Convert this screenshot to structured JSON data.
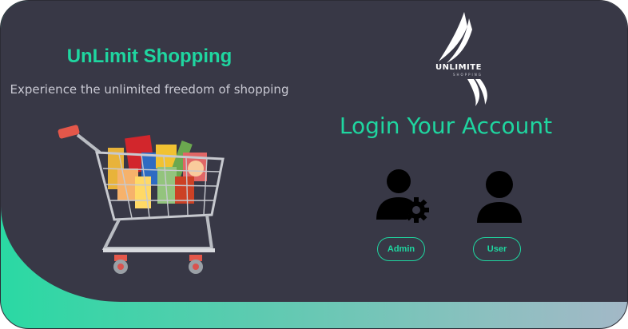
{
  "brand": {
    "title": "UnLimit Shopping",
    "tagline": "Experience the unlimited freedom of shopping",
    "accent_color": "#1fd6a0",
    "logo": {
      "wordmark": "UNLIMITE",
      "sub": "SHOPPING"
    }
  },
  "hero": {
    "image": "shopping-cart-with-groceries"
  },
  "login": {
    "title": "Login Your Account",
    "roles": [
      {
        "icon": "admin-user-gear-icon",
        "label": "Admin"
      },
      {
        "icon": "user-icon",
        "label": "User"
      }
    ]
  },
  "colors": {
    "panel": "#383846",
    "accent": "#1fd6a0",
    "gradient_start": "#2ad9a3",
    "gradient_end": "#a3b8c7"
  }
}
